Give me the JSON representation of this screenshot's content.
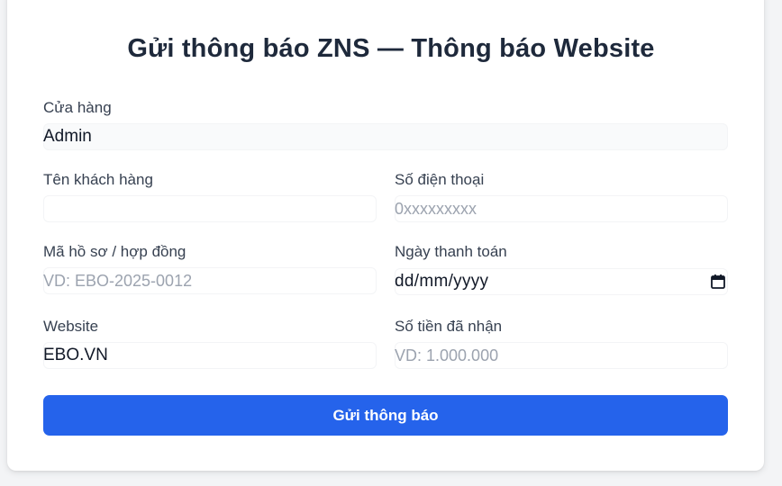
{
  "form": {
    "title": "Gửi thông báo ZNS — Thông báo Website",
    "store": {
      "label": "Cửa hàng",
      "value": "Admin"
    },
    "customer_name": {
      "label": "Tên khách hàng",
      "value": "",
      "placeholder": ""
    },
    "phone": {
      "label": "Số điện thoại",
      "value": "",
      "placeholder": "0xxxxxxxxx"
    },
    "contract_code": {
      "label": "Mã hồ sơ / hợp đồng",
      "value": "",
      "placeholder": "VD: EBO-2025-0012"
    },
    "payment_date": {
      "label": "Ngày thanh toán",
      "value": "dd/mm/yyyy"
    },
    "website": {
      "label": "Website",
      "value": "EBO.VN"
    },
    "amount": {
      "label": "Số tiền đã nhận",
      "value": "",
      "placeholder": "VD: 1.000.000"
    },
    "submit_label": "Gửi thông báo"
  },
  "colors": {
    "accent": "#2563eb",
    "background": "#f3f4f6",
    "card": "#ffffff"
  },
  "icons": {
    "date_picker": "calendar-icon"
  }
}
